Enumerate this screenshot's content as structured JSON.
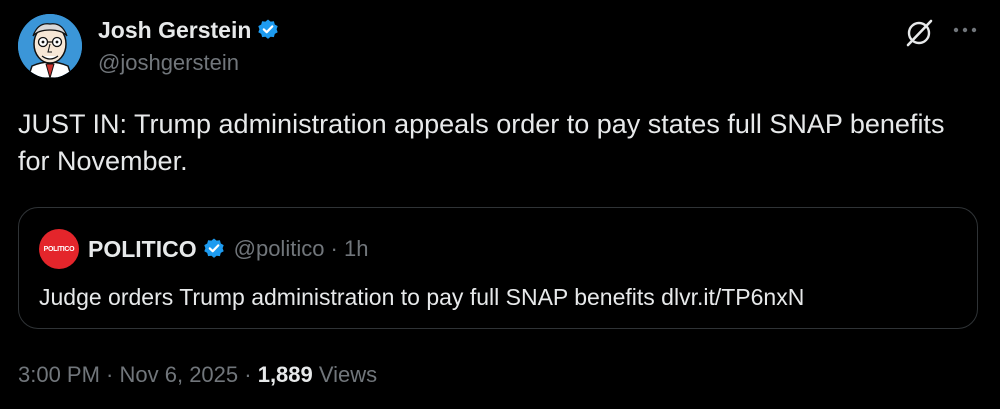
{
  "author": {
    "display_name": "Josh Gerstein",
    "handle": "@joshgerstein",
    "verified": true
  },
  "tweet": {
    "text": "JUST IN: Trump administration appeals order to pay states full SNAP benefits for November."
  },
  "quoted_tweet": {
    "logo_text": "POLITICO",
    "display_name": "POLITICO",
    "handle_time": "@politico · 1h",
    "text": "Judge orders Trump administration to pay full SNAP benefits dlvr.it/TP6nxN"
  },
  "meta": {
    "time": "3:00 PM",
    "sep1": " · ",
    "date": "Nov 6, 2025",
    "sep2": " · ",
    "views_count": "1,889",
    "views_label": " Views"
  },
  "colors": {
    "background": "#000000",
    "text_primary": "#e7e9ea",
    "text_secondary": "#71767b",
    "verified_blue": "#1d9bf0",
    "politico_red": "#e4252b"
  },
  "icons": [
    "verified-badge-icon",
    "grok-icon",
    "more-options-icon",
    "politico-logo"
  ]
}
